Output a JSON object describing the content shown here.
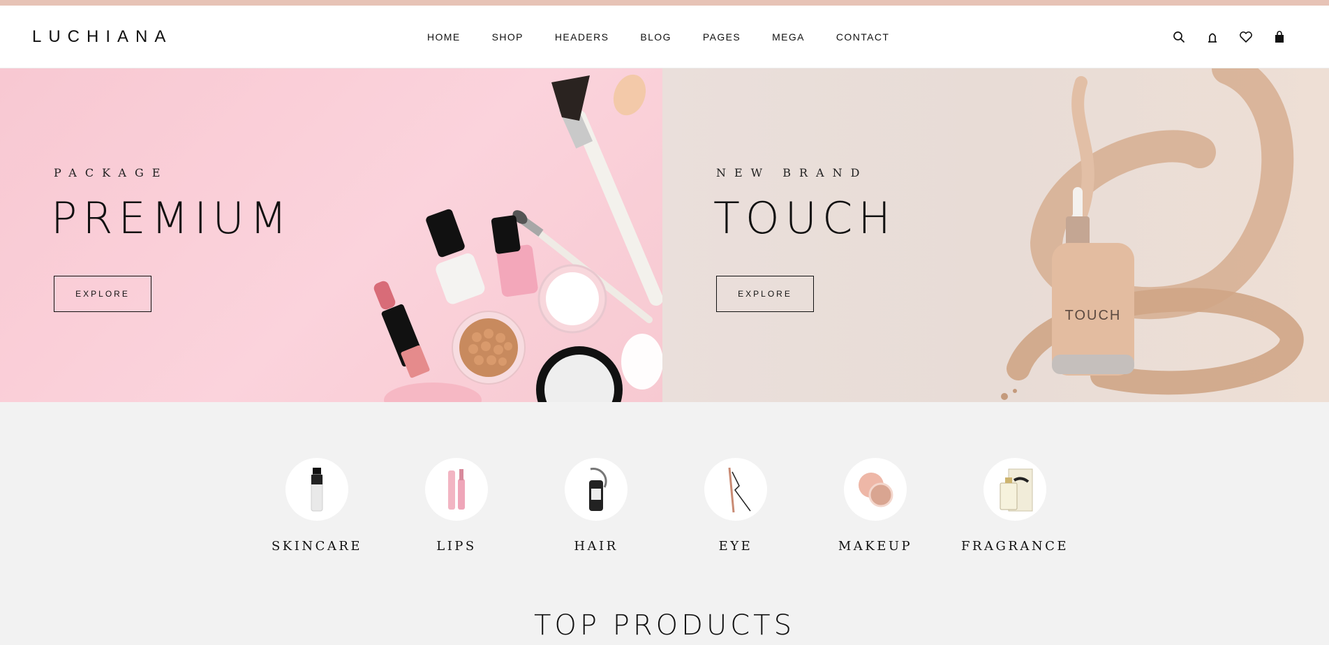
{
  "brand": {
    "logo": "LUCHIANA",
    "topbar_color": "#e7c3b6"
  },
  "nav": {
    "items": [
      {
        "label": "HOME"
      },
      {
        "label": "SHOP"
      },
      {
        "label": "HEADERS"
      },
      {
        "label": "BLOG"
      },
      {
        "label": "PAGES"
      },
      {
        "label": "MEGA"
      },
      {
        "label": "CONTACT"
      }
    ]
  },
  "header_icons": [
    "search-icon",
    "user-icon",
    "heart-icon",
    "bag-icon"
  ],
  "hero": {
    "left": {
      "eyebrow": "PACKAGE",
      "headline": "PREMIUM",
      "button": "EXPLORE",
      "bg": "#f9cdd6"
    },
    "right": {
      "eyebrow": "NEW BRAND",
      "headline": "TOUCH",
      "button": "EXPLORE",
      "bottle_label": "TOUCH",
      "bg": "#e9ddd8"
    }
  },
  "categories": [
    {
      "label": "SKINCARE",
      "icon": "serum-bottle-icon"
    },
    {
      "label": "LIPS",
      "icon": "lipgloss-icon"
    },
    {
      "label": "HAIR",
      "icon": "hair-product-icon"
    },
    {
      "label": "EYE",
      "icon": "eyeliner-icon"
    },
    {
      "label": "MAKEUP",
      "icon": "compact-icon"
    },
    {
      "label": "FRAGRANCE",
      "icon": "perfume-icon"
    }
  ],
  "section": {
    "title": "TOP PRODUCTS"
  }
}
